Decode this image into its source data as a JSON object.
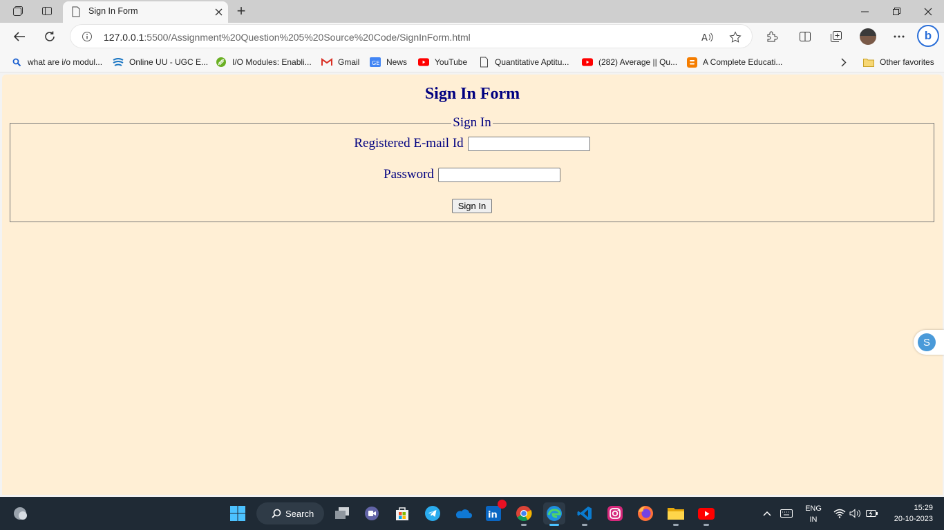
{
  "browser": {
    "tab": {
      "title": "Sign In Form"
    },
    "address": {
      "host": "127.0.0.1",
      "path": ":5500/Assignment%20Question%205%20Source%20Code/SignInForm.html"
    },
    "favorites": [
      {
        "label": "what are i/o modul...",
        "icon": "search-icon"
      },
      {
        "label": "Online UU - UGC E...",
        "icon": "uu-logo-icon"
      },
      {
        "label": "I/O Modules: Enabli...",
        "icon": "leaf-icon"
      },
      {
        "label": "Gmail",
        "icon": "gmail-icon"
      },
      {
        "label": "News",
        "icon": "google-news-icon"
      },
      {
        "label": "YouTube",
        "icon": "youtube-icon"
      },
      {
        "label": "Quantitative Aptitu...",
        "icon": "page-icon"
      },
      {
        "label": "(282) Average || Qu...",
        "icon": "youtube-icon"
      },
      {
        "label": "A Complete Educati...",
        "icon": "blogger-icon"
      }
    ],
    "other_favorites": "Other favorites"
  },
  "page": {
    "heading": "Sign In Form",
    "legend": "Sign In",
    "email_label": "Registered E-mail Id",
    "password_label": "Password",
    "submit_label": "Sign In",
    "side_widget_letter": "S"
  },
  "taskbar": {
    "search_label": "Search",
    "lang_top": "ENG",
    "lang_bottom": "IN",
    "time": "15:29",
    "date": "20-10-2023"
  },
  "colors": {
    "page_background": "#ffefd5",
    "form_text": "#000080"
  }
}
